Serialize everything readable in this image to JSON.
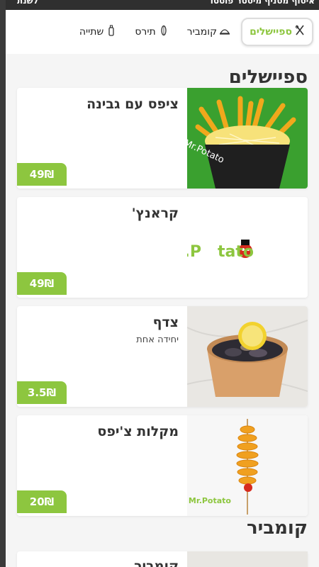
{
  "topbar": {
    "left": "לשנת",
    "right": "איסוף מסניף מיסטר פוטטו"
  },
  "tabs": [
    {
      "label": "ספיישלים",
      "icon": "utensils-icon",
      "active": true
    },
    {
      "label": "קומביר",
      "icon": "cloche-icon",
      "active": false
    },
    {
      "label": "תירס",
      "icon": "corn-icon",
      "active": false
    },
    {
      "label": "שתייה",
      "icon": "bottle-icon",
      "active": false
    }
  ],
  "section_specials": "ספיישלים",
  "items": [
    {
      "name": "ציפס עם גבינה",
      "desc": "",
      "price": "49₪"
    },
    {
      "name": "קראנץ'",
      "desc": "",
      "price": "49₪"
    },
    {
      "name": "צדף",
      "desc": "יחידה אחת",
      "price": "3.5₪"
    },
    {
      "name": "מקלות צ'יפס",
      "desc": "",
      "price": "20₪"
    }
  ],
  "section_kumpir": "קומביר",
  "kumpir_first": {
    "name": "קומביר"
  },
  "brand": {
    "logo_text": "Mr.Potato",
    "logo_primary": "Mr.P",
    "logo_secondary": "tato",
    "accent": "#8dc63f"
  }
}
